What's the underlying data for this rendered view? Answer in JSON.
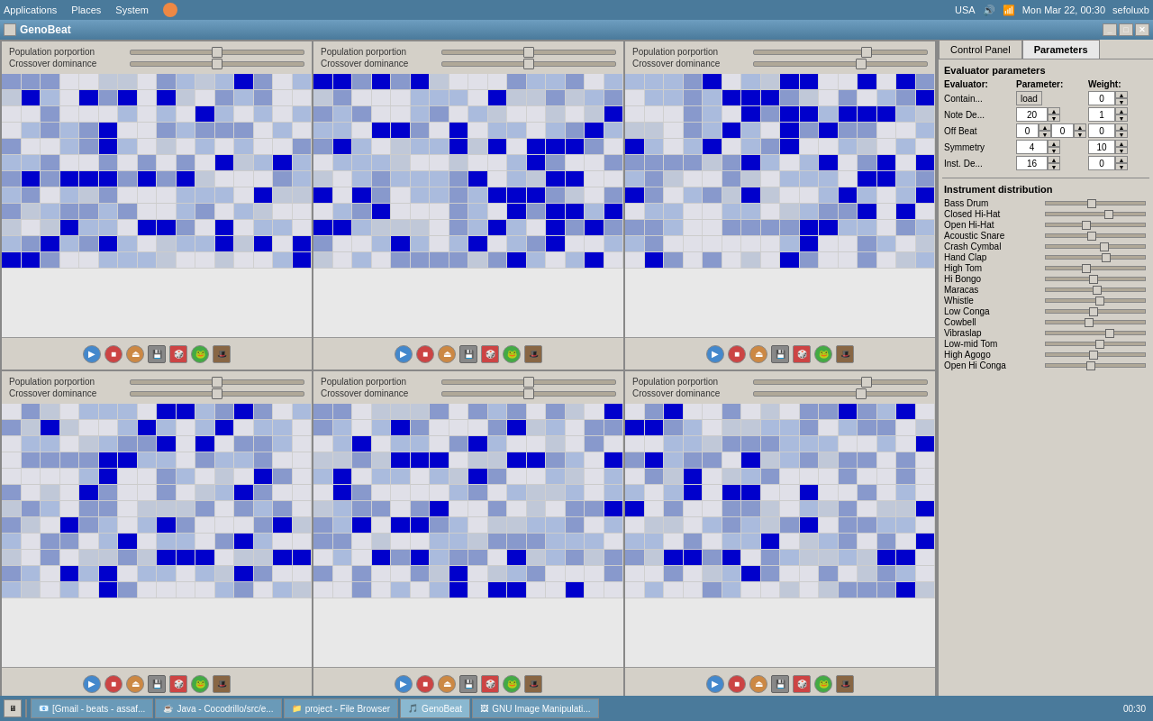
{
  "topbar": {
    "apps": "Applications",
    "places": "Places",
    "system": "System",
    "locale": "USA",
    "datetime": "Mon Mar 22, 00:30",
    "user": "sefoluxb"
  },
  "window": {
    "title": "GenoBeat",
    "minimize": "_",
    "maximize": "□",
    "close": "✕"
  },
  "panels": [
    {
      "pop_label": "Population porportion",
      "cross_label": "Crossover dominance"
    },
    {
      "pop_label": "Population porportion",
      "cross_label": "Crossover dominance"
    },
    {
      "pop_label": "Population porportion",
      "cross_label": "Crossover dominance"
    },
    {
      "pop_label": "Population porportion",
      "cross_label": "Crossover dominance"
    },
    {
      "pop_label": "Population porportion",
      "cross_label": "Crossover dominance"
    },
    {
      "pop_label": "Population porportion",
      "cross_label": "Crossover dominance"
    }
  ],
  "right_panel": {
    "tab_control": "Control Panel",
    "tab_params": "Parameters",
    "evaluator_title": "Evaluator parameters",
    "col_evaluator": "Evaluator:",
    "col_parameter": "Parameter:",
    "col_weight": "Weight:",
    "rows": [
      {
        "label": "Contain...",
        "load": "load",
        "param": "",
        "weight": "0"
      },
      {
        "label": "Note De...",
        "param": "20",
        "weight": "1"
      },
      {
        "label": "Off Beat",
        "param": "0",
        "weight": "0"
      },
      {
        "label": "Symmetry",
        "param": "4",
        "weight": "10"
      },
      {
        "label": "Inst. De...",
        "param": "16",
        "weight": "0"
      }
    ],
    "inst_title": "Instrument distribution",
    "instruments": [
      "Bass Drum",
      "Closed Hi-Hat",
      "Open Hi-Hat",
      "Acoustic Snare",
      "Crash Cymbal",
      "Hand Clap",
      "High Tom",
      "Hi Bongo",
      "Maracas",
      "Whistle",
      "Low Conga",
      "Cowbell",
      "Vibraslap",
      "Low-mid Tom",
      "High Agogo",
      "Open Hi Conga"
    ]
  },
  "taskbar": {
    "items": [
      {
        "label": "[Gmail - beats - assaf..."
      },
      {
        "label": "Java - Cocodrillo/src/e..."
      },
      {
        "label": "project - File Browser"
      },
      {
        "label": "GenoBeat"
      },
      {
        "label": "GNU Image Manipulati..."
      }
    ]
  }
}
